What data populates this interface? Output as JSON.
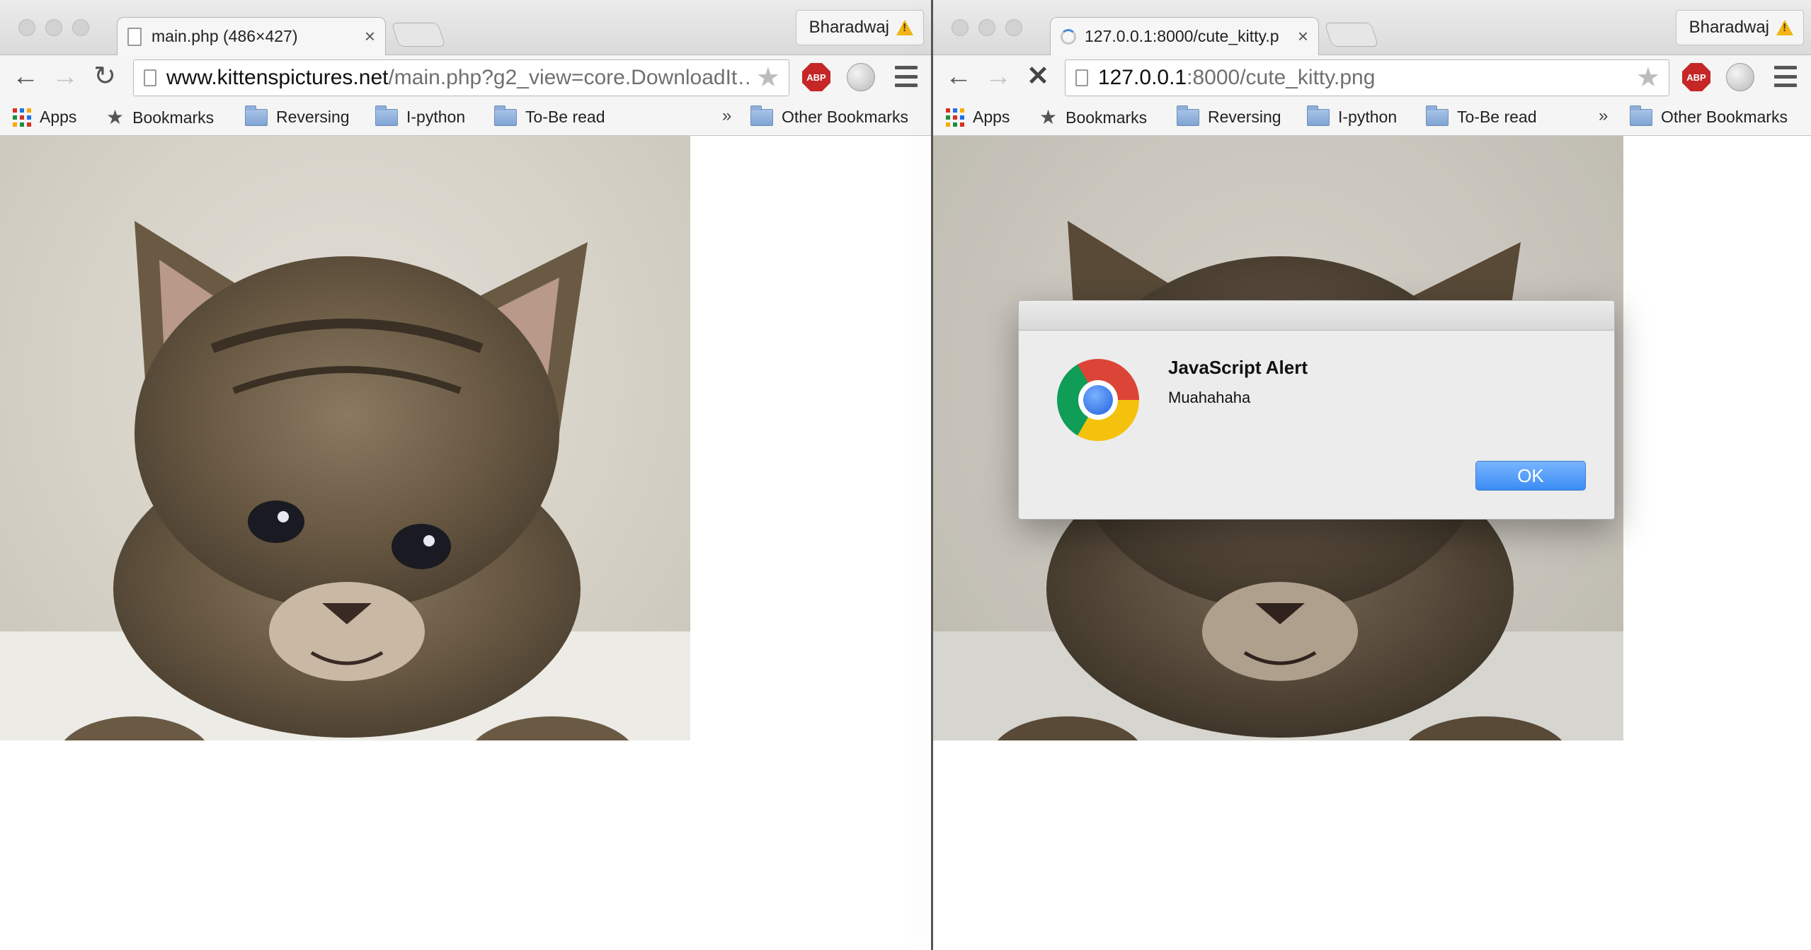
{
  "left_window": {
    "tab": {
      "title": "main.php (486×427)",
      "close": "×"
    },
    "profile": {
      "name": "Bharadwaj",
      "icon": "warning-icon"
    },
    "url": {
      "host": "www.kittenspictures.net",
      "path": "/main.php?g2_view=core.DownloadIt…"
    },
    "toolbar": {
      "back_icon": "←",
      "forward_icon": "→",
      "reload_icon": "↻",
      "star_icon": "★"
    },
    "abp_label": "ABP"
  },
  "right_window": {
    "tab": {
      "title": "127.0.0.1:8000/cute_kitty.p",
      "close": "×"
    },
    "profile": {
      "name": "Bharadwaj",
      "icon": "warning-icon"
    },
    "url": {
      "host": "127.0.0.1",
      "path": ":8000/cute_kitty.png"
    },
    "toolbar": {
      "back_icon": "←",
      "forward_icon": "→",
      "stop_icon": "✕",
      "star_icon": "★"
    },
    "abp_label": "ABP",
    "alert": {
      "title": "JavaScript Alert",
      "message": "Muahahaha",
      "ok_label": "OK"
    }
  },
  "bookmarks": {
    "apps": "Apps",
    "items": [
      "Bookmarks",
      "Reversing",
      "I-python",
      "To-Be read"
    ],
    "overflow": "»",
    "other": "Other Bookmarks"
  },
  "colors": {
    "abp": "#c62626",
    "ok_button": "#3b8cf5",
    "warning": "#f3b515"
  }
}
